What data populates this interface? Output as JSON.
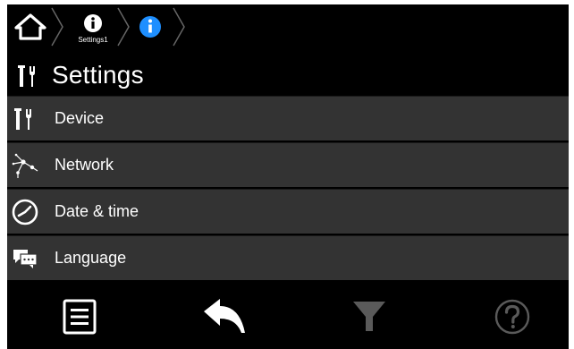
{
  "breadcrumb": {
    "home_icon": "home-icon",
    "items": [
      {
        "label": "Settings1",
        "icon": "info-icon"
      },
      {
        "label": "",
        "icon": "info-icon-active"
      }
    ],
    "active_color": "#1e8fff"
  },
  "page": {
    "title": "Settings",
    "title_icon": "tools-icon"
  },
  "menu": {
    "items": [
      {
        "label": "Device",
        "icon": "tools-icon"
      },
      {
        "label": "Network",
        "icon": "network-icon"
      },
      {
        "label": "Date & time",
        "icon": "clock-icon"
      },
      {
        "label": "Language",
        "icon": "chat-icon"
      }
    ]
  },
  "toolbar": {
    "buttons": [
      {
        "name": "list",
        "icon": "list-icon",
        "enabled": true
      },
      {
        "name": "back",
        "icon": "back-arrow-icon",
        "enabled": true
      },
      {
        "name": "filter",
        "icon": "filter-icon",
        "enabled": false
      },
      {
        "name": "help",
        "icon": "help-icon",
        "enabled": false
      }
    ]
  },
  "colors": {
    "background": "#000000",
    "row": "#333333",
    "accent": "#1e8fff",
    "disabled": "#5a5a5a"
  }
}
